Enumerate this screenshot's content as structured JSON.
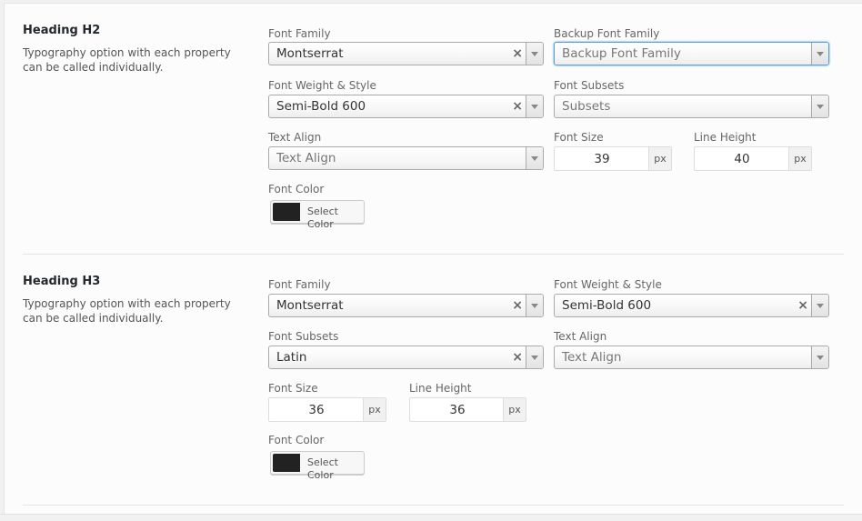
{
  "colors": {
    "accent": "#5b9dd9",
    "swatch": "#222222"
  },
  "labels": {
    "font_family": "Font Family",
    "backup_font_family": "Backup Font Family",
    "font_weight_style": "Font Weight & Style",
    "font_subsets": "Font Subsets",
    "text_align": "Text Align",
    "font_size": "Font Size",
    "line_height": "Line Height",
    "font_color": "Font Color",
    "select_color": "Select Color",
    "px": "px",
    "clear": "×"
  },
  "h2": {
    "title": "Heading H2",
    "description": "Typography option with each property can be called individually.",
    "font_family": "Montserrat",
    "backup_placeholder": "Backup Font Family",
    "font_weight": "Semi-Bold 600",
    "subsets_placeholder": "Subsets",
    "text_align_placeholder": "Text Align",
    "font_size": "39",
    "line_height": "40"
  },
  "h3": {
    "title": "Heading H3",
    "description": "Typography option with each property can be called individually.",
    "font_family": "Montserrat",
    "font_weight": "Semi-Bold 600",
    "font_subsets": "Latin",
    "text_align_placeholder": "Text Align",
    "font_size": "36",
    "line_height": "36"
  }
}
